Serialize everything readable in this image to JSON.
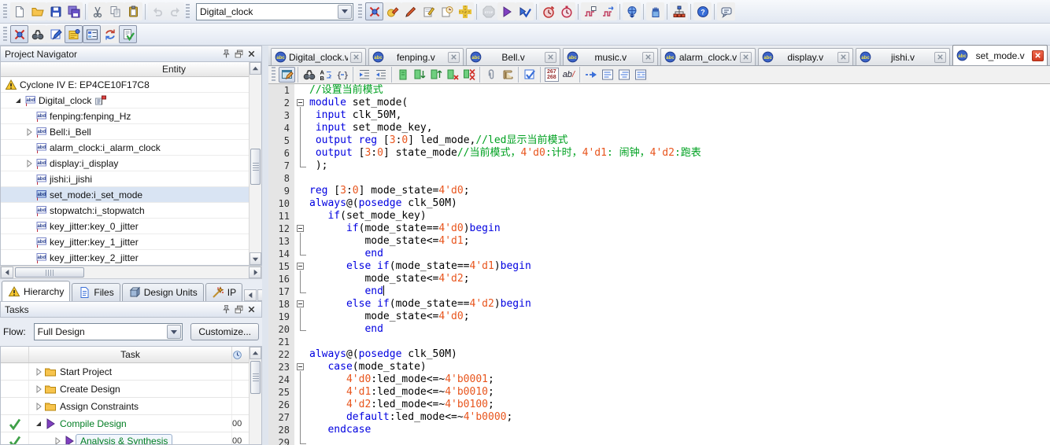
{
  "toolbar_main": {
    "project_dropdown": "Digital_clock",
    "groups": [
      {
        "icons": [
          {
            "name": "doc-new"
          },
          {
            "name": "folder-open"
          },
          {
            "name": "save"
          },
          {
            "name": "save-all"
          }
        ]
      },
      {
        "icons": [
          {
            "name": "cut"
          },
          {
            "name": "copy"
          },
          {
            "name": "paste"
          }
        ]
      },
      {
        "icons": [
          {
            "name": "undo",
            "disabled": true
          },
          {
            "name": "redo",
            "disabled": true
          }
        ]
      },
      {
        "dropdown": true
      },
      {
        "icons": [
          {
            "name": "netlist-x",
            "pressed": true
          },
          {
            "name": "assign-pencil"
          },
          {
            "name": "pencil"
          },
          {
            "name": "pad-pencil"
          },
          {
            "name": "pad-clock"
          },
          {
            "name": "roads"
          }
        ]
      },
      {
        "icons": [
          {
            "name": "stop",
            "disabled": true
          },
          {
            "name": "play"
          },
          {
            "name": "play-check"
          }
        ]
      },
      {
        "icons": [
          {
            "name": "clock-run"
          },
          {
            "name": "stopwatch"
          }
        ]
      },
      {
        "icons": [
          {
            "name": "wave-in"
          },
          {
            "name": "wave-out"
          }
        ]
      },
      {
        "icons": [
          {
            "name": "globe-down"
          }
        ]
      },
      {
        "icons": [
          {
            "name": "hand-chip"
          }
        ]
      },
      {
        "icons": [
          {
            "name": "orgchart"
          }
        ]
      },
      {
        "icons": [
          {
            "name": "help"
          }
        ]
      },
      {
        "icons": [
          {
            "name": "feedback"
          }
        ]
      }
    ]
  },
  "toolbar_secondary": {
    "icons": [
      {
        "name": "netlist-x",
        "pressed": true
      },
      {
        "name": "binoculars"
      },
      {
        "name": "edit-square"
      },
      {
        "name": "note",
        "pressed": true
      },
      {
        "name": "list-blue",
        "pressed": true
      },
      {
        "name": "refresh"
      },
      {
        "name": "check-doc",
        "pressed": true
      }
    ]
  },
  "project_navigator": {
    "title": "Project Navigator",
    "column_header": "Entity",
    "tree": [
      {
        "icon": "warn",
        "label": "Cyclone IV E: EP4CE10F17C8",
        "ind": 0
      },
      {
        "icon": "abd",
        "label": "Digital_clock",
        "ind": 1,
        "arrow": "expanded",
        "extra": "flag-mod"
      },
      {
        "icon": "abd",
        "label": "fenping:fenping_Hz",
        "ind": 2
      },
      {
        "icon": "abd",
        "label": "Bell:i_Bell",
        "ind": 2,
        "arrow": "collapsed"
      },
      {
        "icon": "abd",
        "label": "alarm_clock:i_alarm_clock",
        "ind": 2
      },
      {
        "icon": "abd",
        "label": "display:i_display",
        "ind": 2,
        "arrow": "collapsed"
      },
      {
        "icon": "abd",
        "label": "jishi:i_jishi",
        "ind": 2
      },
      {
        "icon": "abd",
        "label": "set_mode:i_set_mode",
        "ind": 2,
        "selected": true
      },
      {
        "icon": "abd",
        "label": "stopwatch:i_stopwatch",
        "ind": 2
      },
      {
        "icon": "abd",
        "label": "key_jitter:key_0_jitter",
        "ind": 2
      },
      {
        "icon": "abd",
        "label": "key_jitter:key_1_jitter",
        "ind": 2
      },
      {
        "icon": "abd",
        "label": "key_jitter:key_2_jitter",
        "ind": 2
      }
    ],
    "tabs": [
      {
        "label": "Hierarchy",
        "icon": "warn",
        "active": true
      },
      {
        "label": "Files",
        "icon": "file-blue"
      },
      {
        "label": "Design Units",
        "icon": "cube"
      },
      {
        "label": "IP",
        "icon": "wand"
      }
    ]
  },
  "tasks": {
    "title": "Tasks",
    "flow_label": "Flow:",
    "flow_value": "Full Design",
    "customize_label": "Customize...",
    "column_header": "Task",
    "rows": [
      {
        "label": "Start Project",
        "icon": "folder",
        "arrow": "collapsed",
        "ind": 0,
        "time": ""
      },
      {
        "label": "Create Design",
        "icon": "folder",
        "arrow": "collapsed",
        "ind": 0,
        "time": ""
      },
      {
        "label": "Assign Constraints",
        "icon": "folder",
        "arrow": "collapsed",
        "ind": 0,
        "time": ""
      },
      {
        "label": "Compile Design",
        "icon": "play",
        "arrow": "expanded",
        "ind": 0,
        "check": true,
        "green": true,
        "time": "00"
      },
      {
        "label": "Analysis & Synthesis",
        "icon": "play",
        "arrow": "collapsed",
        "ind": 1,
        "check": true,
        "green": true,
        "focused": true,
        "time": "00"
      }
    ]
  },
  "editor": {
    "tabs": [
      {
        "label": "Digital_clock.v"
      },
      {
        "label": "fenping.v"
      },
      {
        "label": "Bell.v"
      },
      {
        "label": "music.v"
      },
      {
        "label": "alarm_clock.v"
      },
      {
        "label": "display.v"
      },
      {
        "label": "jishi.v"
      },
      {
        "label": "set_mode.v",
        "active": true
      }
    ],
    "toolbar": [
      {
        "name": "win-pencil",
        "pressed": true
      },
      {
        "sep": true
      },
      {
        "name": "binoculars"
      },
      {
        "name": "az-replace"
      },
      {
        "name": "braces"
      },
      {
        "sep": true
      },
      {
        "name": "indent-inc"
      },
      {
        "name": "indent-dec"
      },
      {
        "sep": true
      },
      {
        "name": "bm-add"
      },
      {
        "name": "bm-next"
      },
      {
        "name": "bm-prev"
      },
      {
        "name": "bm-del"
      },
      {
        "name": "bm-delall"
      },
      {
        "sep": true
      },
      {
        "name": "paperclip"
      },
      {
        "name": "scroll"
      },
      {
        "sep": true
      },
      {
        "name": "check-blue"
      },
      {
        "sep": true
      },
      {
        "counter": [
          "267",
          "268"
        ]
      },
      {
        "name": "ab-slash"
      },
      {
        "sep": true
      },
      {
        "name": "arrow-right-blue"
      },
      {
        "name": "list-ind1"
      },
      {
        "name": "list-ind2"
      },
      {
        "name": "list-ind3"
      }
    ],
    "syntax_colors": {
      "keyword": "#0000E0",
      "comment": "#00A121",
      "number": "#E8551D",
      "plain": "#000000"
    },
    "lines": [
      {
        "fold": "",
        "seg": [
          [
            "c",
            "//设置当前模式"
          ]
        ]
      },
      {
        "fold": "box",
        "seg": [
          [
            "k",
            "module"
          ],
          [
            "p",
            " set_mode("
          ]
        ]
      },
      {
        "fold": "line",
        "seg": [
          [
            "p",
            " "
          ],
          [
            "k",
            "input"
          ],
          [
            "p",
            " clk_50M,"
          ]
        ]
      },
      {
        "fold": "line",
        "seg": [
          [
            "p",
            " "
          ],
          [
            "k",
            "input"
          ],
          [
            "p",
            " set_mode_key,"
          ]
        ]
      },
      {
        "fold": "line",
        "seg": [
          [
            "p",
            " "
          ],
          [
            "k",
            "output"
          ],
          [
            "p",
            " "
          ],
          [
            "k",
            "reg"
          ],
          [
            "p",
            " ["
          ],
          [
            "n",
            "3"
          ],
          [
            "p",
            ":"
          ],
          [
            "n",
            "0"
          ],
          [
            "p",
            "] led_mode,"
          ],
          [
            "c",
            "//led显示当前模式"
          ]
        ]
      },
      {
        "fold": "line",
        "seg": [
          [
            "p",
            " "
          ],
          [
            "k",
            "output"
          ],
          [
            "p",
            " ["
          ],
          [
            "n",
            "3"
          ],
          [
            "p",
            ":"
          ],
          [
            "n",
            "0"
          ],
          [
            "p",
            "] state_mode"
          ],
          [
            "c",
            "//当前模式，"
          ],
          [
            "n",
            "4'd0"
          ],
          [
            "c",
            ":计时，"
          ],
          [
            "n",
            "4'd1"
          ],
          [
            "c",
            ": 闹钟，"
          ],
          [
            "n",
            "4'd2"
          ],
          [
            "c",
            ":跑表"
          ]
        ]
      },
      {
        "fold": "corner",
        "seg": [
          [
            "p",
            " );"
          ]
        ]
      },
      {
        "fold": "",
        "seg": []
      },
      {
        "fold": "",
        "seg": [
          [
            "k",
            "reg"
          ],
          [
            "p",
            " ["
          ],
          [
            "n",
            "3"
          ],
          [
            "p",
            ":"
          ],
          [
            "n",
            "0"
          ],
          [
            "p",
            "] mode_state="
          ],
          [
            "n",
            "4'd0"
          ],
          [
            "p",
            ";"
          ]
        ]
      },
      {
        "fold": "",
        "seg": [
          [
            "k",
            "always"
          ],
          [
            "p",
            "@("
          ],
          [
            "k",
            "posedge"
          ],
          [
            "p",
            " clk_50M)"
          ]
        ]
      },
      {
        "fold": "",
        "seg": [
          [
            "p",
            "   "
          ],
          [
            "k",
            "if"
          ],
          [
            "p",
            "(set_mode_key)"
          ]
        ]
      },
      {
        "fold": "box",
        "seg": [
          [
            "p",
            "      "
          ],
          [
            "k",
            "if"
          ],
          [
            "p",
            "(mode_state=="
          ],
          [
            "n",
            "4'd0"
          ],
          [
            "p",
            ")"
          ],
          [
            "k",
            "begin"
          ]
        ]
      },
      {
        "fold": "line",
        "seg": [
          [
            "p",
            "         mode_state<="
          ],
          [
            "n",
            "4'd1"
          ],
          [
            "p",
            ";"
          ]
        ]
      },
      {
        "fold": "corner",
        "seg": [
          [
            "p",
            "         "
          ],
          [
            "k",
            "end"
          ]
        ]
      },
      {
        "fold": "box",
        "seg": [
          [
            "p",
            "      "
          ],
          [
            "k",
            "else"
          ],
          [
            "p",
            " "
          ],
          [
            "k",
            "if"
          ],
          [
            "p",
            "(mode_state=="
          ],
          [
            "n",
            "4'd1"
          ],
          [
            "p",
            ")"
          ],
          [
            "k",
            "begin"
          ]
        ]
      },
      {
        "fold": "line",
        "seg": [
          [
            "p",
            "         mode_state<="
          ],
          [
            "n",
            "4'd2"
          ],
          [
            "p",
            ";"
          ]
        ]
      },
      {
        "fold": "corner",
        "seg": [
          [
            "p",
            "         "
          ],
          [
            "k",
            "end"
          ],
          [
            "caret",
            ""
          ]
        ]
      },
      {
        "fold": "box",
        "seg": [
          [
            "p",
            "      "
          ],
          [
            "k",
            "else"
          ],
          [
            "p",
            " "
          ],
          [
            "k",
            "if"
          ],
          [
            "p",
            "(mode_state=="
          ],
          [
            "n",
            "4'd2"
          ],
          [
            "p",
            ")"
          ],
          [
            "k",
            "begin"
          ]
        ]
      },
      {
        "fold": "line",
        "seg": [
          [
            "p",
            "         mode_state<="
          ],
          [
            "n",
            "4'd0"
          ],
          [
            "p",
            ";"
          ]
        ]
      },
      {
        "fold": "corner",
        "seg": [
          [
            "p",
            "         "
          ],
          [
            "k",
            "end"
          ]
        ]
      },
      {
        "fold": "",
        "seg": []
      },
      {
        "fold": "",
        "seg": [
          [
            "k",
            "always"
          ],
          [
            "p",
            "@("
          ],
          [
            "k",
            "posedge"
          ],
          [
            "p",
            " clk_50M)"
          ]
        ]
      },
      {
        "fold": "box",
        "seg": [
          [
            "p",
            "   "
          ],
          [
            "k",
            "case"
          ],
          [
            "p",
            "(mode_state)"
          ]
        ]
      },
      {
        "fold": "line",
        "seg": [
          [
            "p",
            "      "
          ],
          [
            "n",
            "4'd0"
          ],
          [
            "p",
            ":led_mode<=~"
          ],
          [
            "n",
            "4'b0001"
          ],
          [
            "p",
            ";"
          ]
        ]
      },
      {
        "fold": "line",
        "seg": [
          [
            "p",
            "      "
          ],
          [
            "n",
            "4'd1"
          ],
          [
            "p",
            ":led_mode<=~"
          ],
          [
            "n",
            "4'b0010"
          ],
          [
            "p",
            ";"
          ]
        ]
      },
      {
        "fold": "line",
        "seg": [
          [
            "p",
            "      "
          ],
          [
            "n",
            "4'd2"
          ],
          [
            "p",
            ":led_mode<=~"
          ],
          [
            "n",
            "4'b0100"
          ],
          [
            "p",
            ";"
          ]
        ]
      },
      {
        "fold": "line",
        "seg": [
          [
            "p",
            "      "
          ],
          [
            "k",
            "default"
          ],
          [
            "p",
            ":led_mode<=~"
          ],
          [
            "n",
            "4'b0000"
          ],
          [
            "p",
            ";"
          ]
        ]
      },
      {
        "fold": "line",
        "seg": [
          [
            "p",
            "   "
          ],
          [
            "k",
            "endcase"
          ]
        ]
      },
      {
        "fold": "corner",
        "seg": []
      }
    ]
  }
}
